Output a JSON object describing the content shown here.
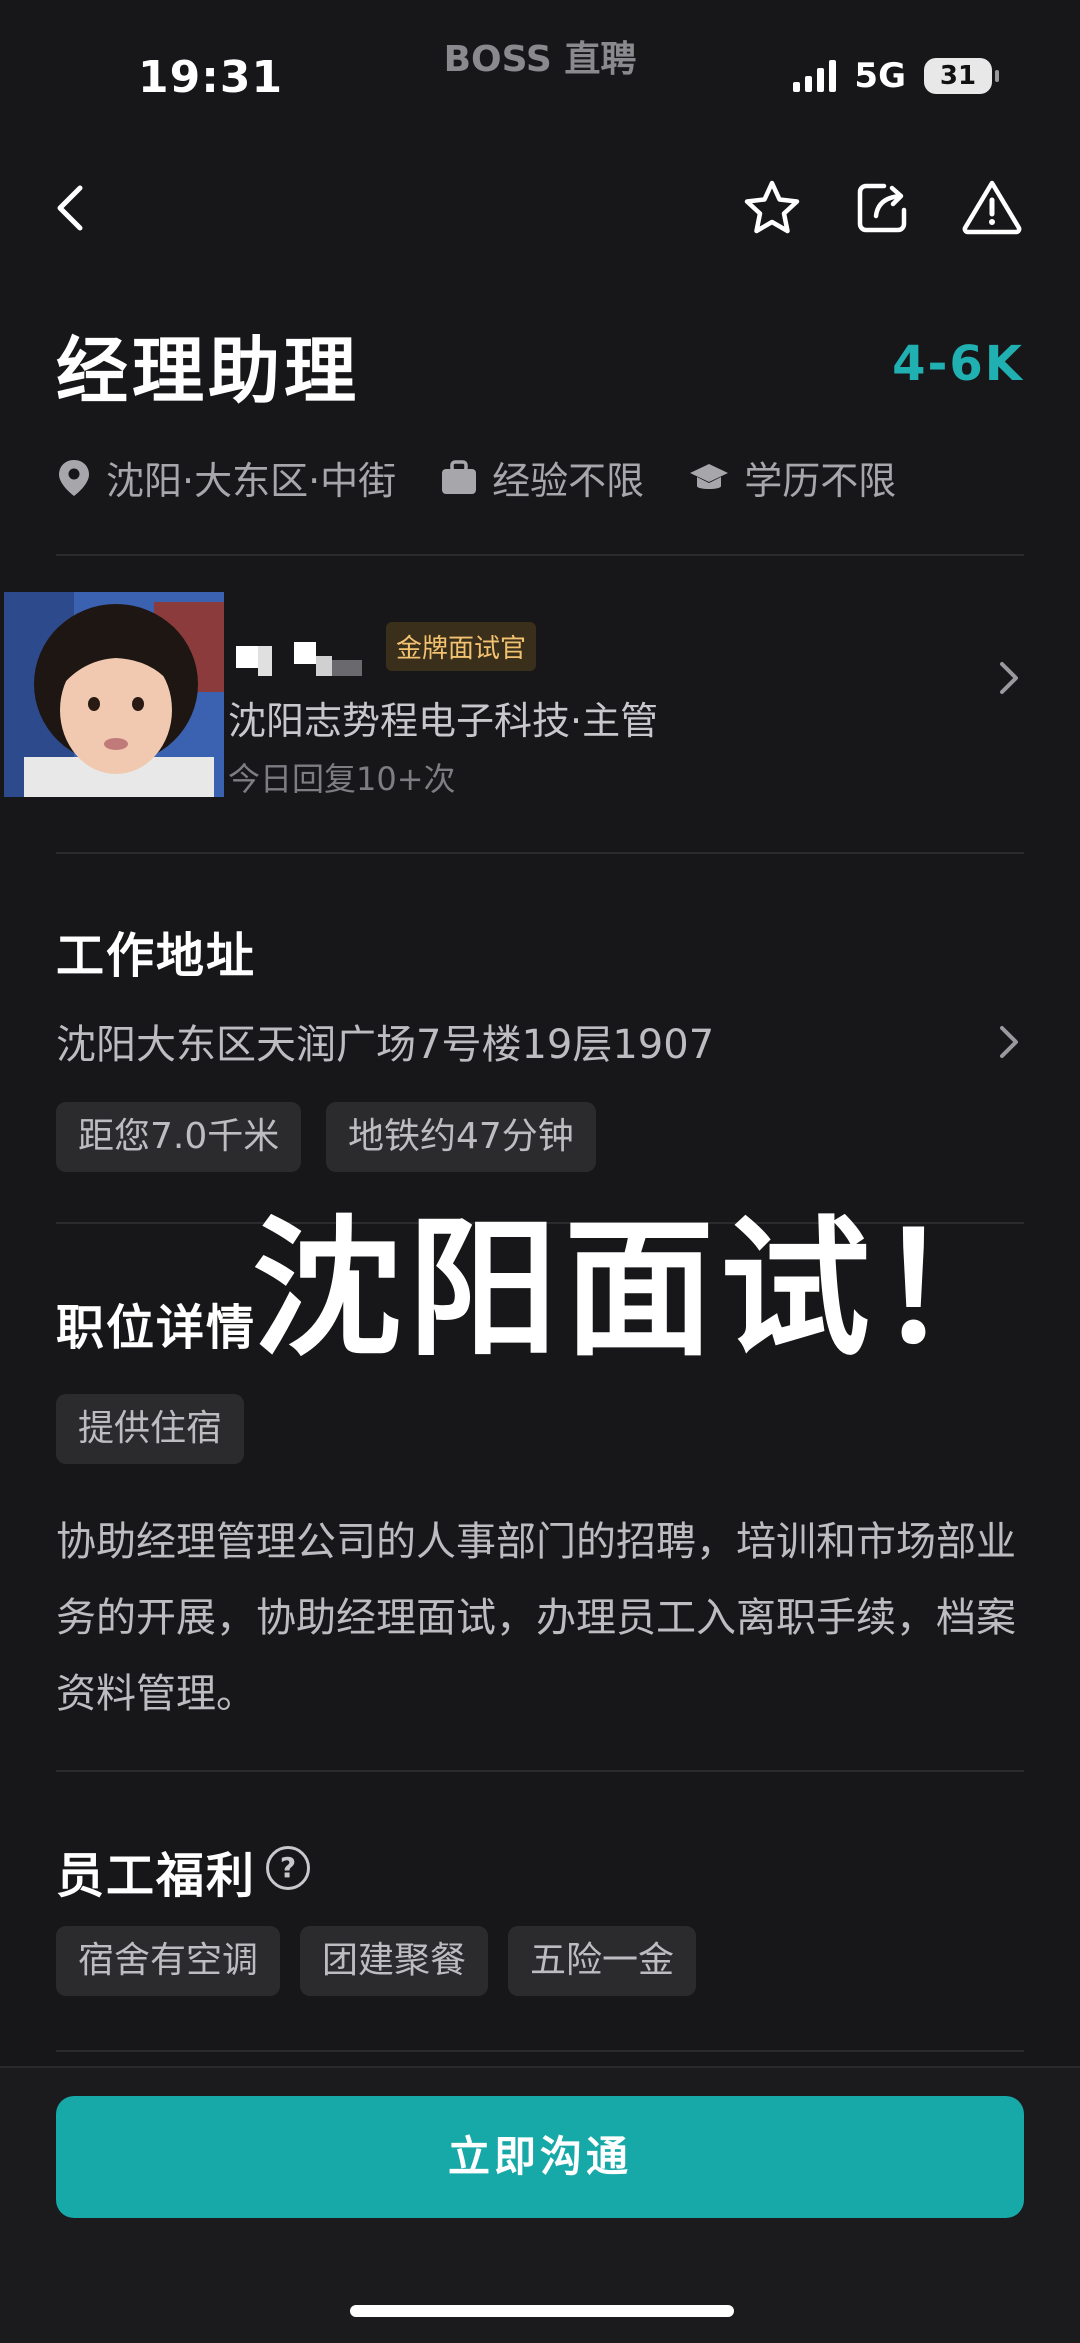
{
  "status": {
    "time": "19:31",
    "app_label": "BOSS 直聘",
    "network": "5G",
    "battery": "31"
  },
  "nav": {
    "back": "back-icon",
    "favorite": "star-icon",
    "share": "share-icon",
    "report": "warning-icon"
  },
  "job": {
    "title": "经理助理",
    "salary": "4-6K",
    "location": "沈阳·大东区·中街",
    "experience": "经验不限",
    "education": "学历不限"
  },
  "recruiter": {
    "badge": "金牌面试官",
    "company": "沈阳志势程电子科技·主管",
    "reply": "今日回复10+次"
  },
  "work_address": {
    "title": "工作地址",
    "address": "沈阳大东区天润广场7号楼19层1907",
    "tags": [
      "距您7.0千米",
      "地铁约47分钟"
    ]
  },
  "overlay_text": "沈阳面试！",
  "job_detail": {
    "title": "职位详情",
    "tags": [
      "提供住宿"
    ],
    "description": "协助经理管理公司的人事部门的招聘，培训和市场部业务的开展，协助经理面试，办理员工入离职手续，档案资料管理。"
  },
  "benefits": {
    "title": "员工福利",
    "help_icon": "?",
    "tags": [
      "宿舍有空调",
      "团建聚餐",
      "五险一金"
    ]
  },
  "cta": "立即沟通",
  "colors": {
    "accent": "#20b0b2",
    "button": "#17a8a8",
    "background": "#171719"
  }
}
